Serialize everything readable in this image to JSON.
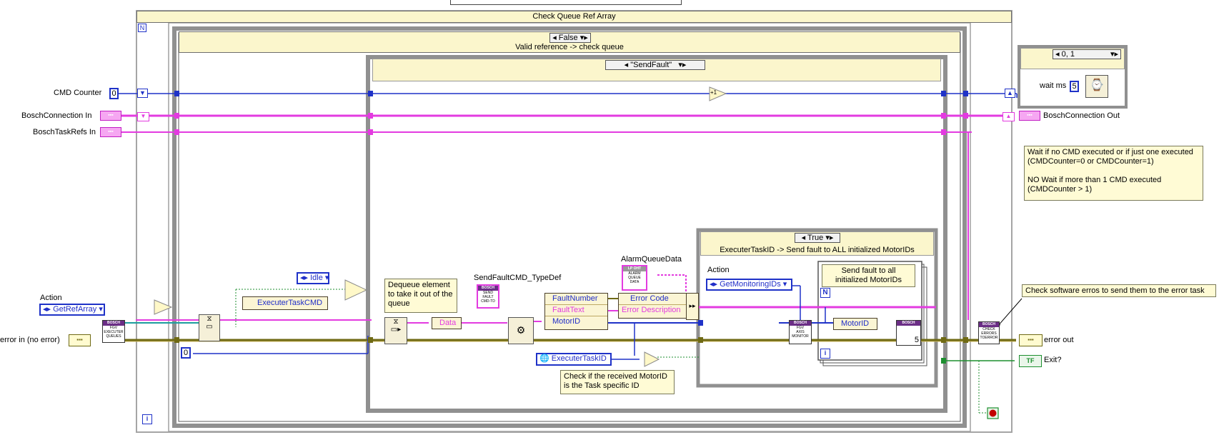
{
  "top_box": {
    "label": ""
  },
  "structures": {
    "outer_case_title": "Check Queue Ref Array",
    "false_case_selector": "False",
    "false_case_title": "Valid reference -> check queue",
    "sendfault_case_selector": "\"SendFault\"",
    "true_case_selector": "True",
    "true_case_title": "ExecuterTaskID -> Send fault to ALL initialized MotorIDs",
    "wait_case_selector": "0, 1",
    "for_loop_count": "N",
    "for_loop_iteration": "i",
    "while_loop_iteration": "i",
    "no_index_glyph": "N"
  },
  "controls": {
    "cmd_counter_label": "CMD Counter",
    "cmd_counter_value": "0",
    "bosch_connection_in": "BoschConnection In",
    "bosch_task_refs_in": "BoschTaskRefs In",
    "action_label": "Action",
    "action_value": "GetRefArray",
    "error_in": "error in (no error)"
  },
  "indicators": {
    "bosch_connection_out": "BoschConnection Out",
    "error_out": "error out",
    "exit": "Exit?",
    "exit_terminal": "TF"
  },
  "nodes": {
    "idle_enum": "Idle",
    "executer_task_cmd": "ExecuterTaskCMD",
    "data_unbundle": "Data",
    "zero_constant": "0",
    "sendfault_typedef_label": "SendFaultCMD_TypeDef",
    "alarm_queue_data_label": "AlarmQueueData",
    "bundle_fields": [
      "FaultNumber",
      "FaultText",
      "MotorID"
    ],
    "error_fields": [
      "Error Code",
      "Error Description"
    ],
    "executer_task_id": "ExecuterTaskID",
    "action2_label": "Action",
    "action2_value": "GetMonitoringIDs",
    "motorid_unbundle": "MotorID",
    "increment": "+1",
    "wait_label": "wait ms",
    "wait_value": "5",
    "inner_count": "5"
  },
  "subvis": {
    "fgv_queues": [
      "BOSCH",
      "FGV",
      "EXECUTER",
      "QUEUES"
    ],
    "send_fault": [
      "BOSCH",
      "SEND",
      "FAULT",
      "CMD-TD"
    ],
    "alarm_queue": [
      "LP OHT",
      "ALARM",
      "QUEUE",
      "DATA"
    ],
    "fgv_axis": [
      "BOSCH",
      "FGV",
      "AXIS",
      "MONITOR"
    ],
    "motor_vi": [
      "BOSCH"
    ],
    "check_errors": [
      "BOSCH",
      "CHECK",
      "ERRORS",
      "TOERROR"
    ]
  },
  "comments": {
    "dequeue": "Dequeue element to take it out of the queue",
    "check_motor": "Check if the received MotorID is the Task specific ID",
    "send_fault": "Send fault to all initialized MotorIDs",
    "wait_note": "Wait if no CMD executed or if just one executed (CMDCounter=0 or CMDCounter=1)\n\nNO Wait if more than 1 CMD executed (CMDCounter > 1)",
    "check_sw_errors": "Check software erros to send them to the error task"
  },
  "colors": {
    "error_wire": "#6f6a14",
    "cluster_wire": "#e33be0",
    "numeric_wire": "#1f32c8",
    "bool_wire": "#1d8f2f",
    "case_frame": "#d0d0d0"
  }
}
